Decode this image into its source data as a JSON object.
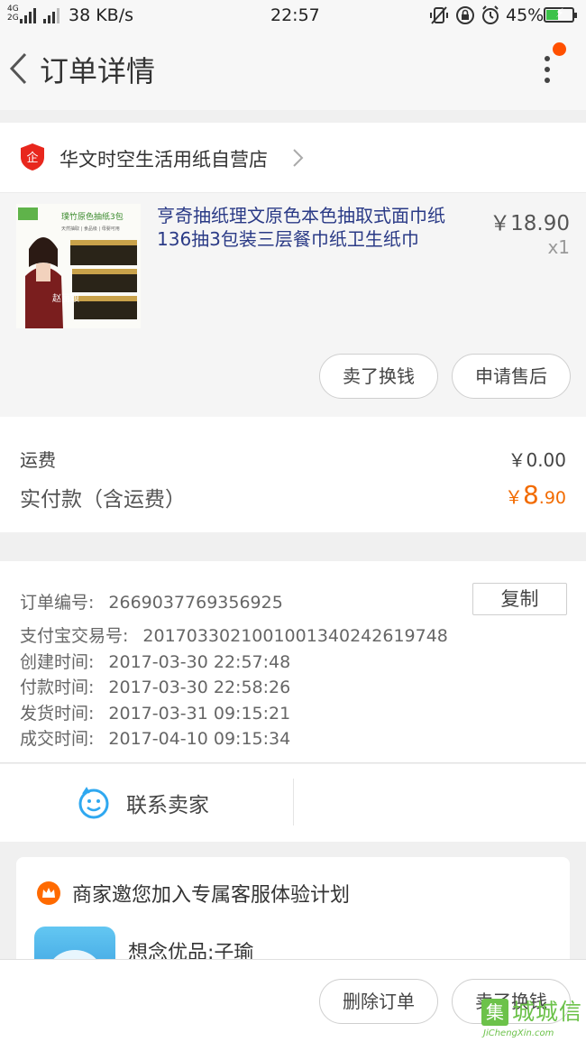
{
  "status_bar": {
    "net_top": "4G",
    "net_bottom": "2G",
    "speed": "38 KB/s",
    "time": "22:57",
    "battery_pct": "45%",
    "battery_level": 0.45
  },
  "header": {
    "title": "订单详情"
  },
  "shop": {
    "name": "华文时空生活用纸自营店"
  },
  "product": {
    "title": "亨奇抽纸理文原色本色抽取式面巾纸136抽3包装三层餐巾纸卫生纸巾",
    "price": "￥18.90",
    "quantity": "x1",
    "image_text": "璞竹原色抽纸3包",
    "image_sub": "天然抽取 | 食品级 | 母婴可用",
    "image_brand": "赵丽颖",
    "sell_label": "卖了换钱",
    "aftersale_label": "申请售后"
  },
  "fees": {
    "shipping_label": "运费",
    "shipping_value": "￥0.00",
    "paid_label": "实付款（含运费）",
    "paid_currency": "￥",
    "paid_int": "8",
    "paid_dec": ".90",
    "paid_color": "#f26b00"
  },
  "order_info": {
    "copy_label": "复制",
    "rows": [
      {
        "label": "订单编号:",
        "value": "2669037769356925"
      },
      {
        "label": "支付宝交易号:",
        "value": "2017033021001001340242619748"
      },
      {
        "label": "创建时间:",
        "value": "2017-03-30 22:57:48"
      },
      {
        "label": "付款时间:",
        "value": "2017-03-30 22:58:26"
      },
      {
        "label": "发货时间:",
        "value": "2017-03-31 09:15:21"
      },
      {
        "label": "成交时间:",
        "value": "2017-04-10 09:15:34"
      }
    ]
  },
  "contact": {
    "label": "联系卖家"
  },
  "invite": {
    "title": "商家邀您加入专属客服体验计划",
    "cs_name": "想念优品:子瑜"
  },
  "bottom": {
    "delete_label": "删除订单",
    "sell_label": "卖了换钱"
  },
  "watermark": {
    "cn": "城城信",
    "badge": "集",
    "en": "JiChengXin.com"
  },
  "colors": {
    "accent": "#ff5000",
    "price_orange": "#f26b00",
    "title_blue": "#2a3a86"
  }
}
